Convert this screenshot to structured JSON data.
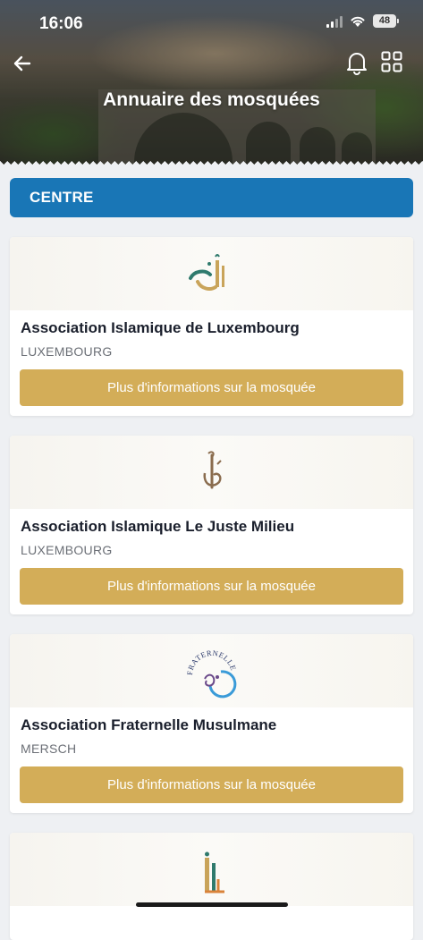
{
  "status_bar": {
    "time": "16:06",
    "battery": "48"
  },
  "header": {
    "title": "Annuaire des mosquées",
    "back_icon": "arrow-left-icon",
    "bell_icon": "bell-icon",
    "grid_icon": "grid-icon"
  },
  "section": {
    "label": "CENTRE"
  },
  "colors": {
    "section_blue": "#1976b6",
    "button_gold": "#d3ad58"
  },
  "mosques": [
    {
      "name": "Association Islamique de Luxembourg",
      "city": "LUXEMBOURG",
      "button": "Plus d'informations sur la mosquée",
      "logo": "mosque-logo-aidl"
    },
    {
      "name": "Association Islamique Le Juste Milieu",
      "city": "LUXEMBOURG",
      "button": "Plus d'informations sur la mosquée",
      "logo": "calligraphy-logo"
    },
    {
      "name": "Association Fraternelle Musulmane",
      "city": "MERSCH",
      "button": "Plus d'informations sur la mosquée",
      "logo": "fraternelle-logo",
      "logo_text": "FRATERNELLE"
    },
    {
      "name": "",
      "city": "",
      "button": "",
      "logo": "minaret-logo"
    }
  ]
}
